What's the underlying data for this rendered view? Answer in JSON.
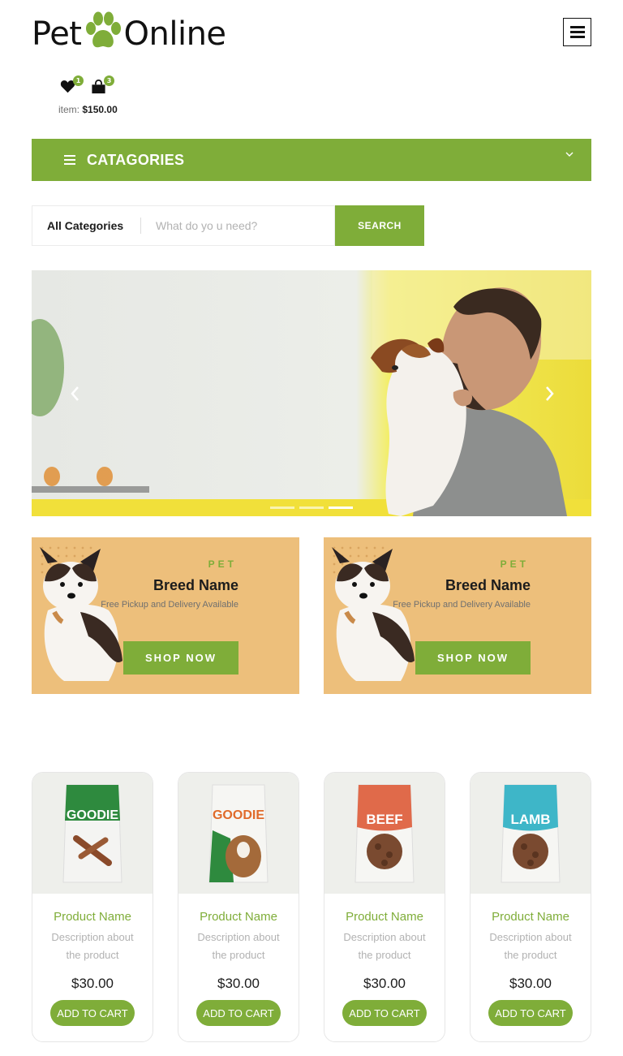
{
  "brand": {
    "word1": "Pet",
    "word2": "Online"
  },
  "header": {
    "wishlist_count": "1",
    "cart_count": "3",
    "cart_total_label": "item:",
    "cart_total_value": "$150.00"
  },
  "categories": {
    "title": "CATAGORIES"
  },
  "search": {
    "category": "All Categories",
    "placeholder": "What do yo u need?",
    "button": "SEARCH"
  },
  "banners": [
    {
      "label": "PET",
      "title": "Breed Name",
      "subtitle": "Free Pickup and Delivery Available",
      "button": "SHOP NOW"
    },
    {
      "label": "PET",
      "title": "Breed Name",
      "subtitle": "Free Pickup and Delivery Available",
      "button": "SHOP NOW"
    }
  ],
  "products": [
    {
      "pack_text": "GOODIE",
      "name": "Product Name",
      "desc": "Description about the product",
      "price": "$30.00",
      "button": "ADD TO CART"
    },
    {
      "pack_text": "GOODIE",
      "name": "Product Name",
      "desc": "Description about the product",
      "price": "$30.00",
      "button": "ADD TO CART"
    },
    {
      "pack_text": "BEEF",
      "name": "Product Name",
      "desc": "Description about the product",
      "price": "$30.00",
      "button": "ADD TO CART"
    },
    {
      "pack_text": "LAMB",
      "name": "Product Name",
      "desc": "Description about the product",
      "price": "$30.00",
      "button": "ADD TO CART"
    }
  ],
  "colors": {
    "accent": "#7fad39",
    "banner_bg": "#edbf7b",
    "text_dark": "#1c1c1c",
    "text_muted": "#b2b2b2"
  },
  "icons": [
    "paw-icon",
    "hamburger-menu-icon",
    "heart-icon",
    "shopping-bag-icon",
    "chevron-down-icon",
    "arrow-left-icon",
    "arrow-right-icon"
  ]
}
